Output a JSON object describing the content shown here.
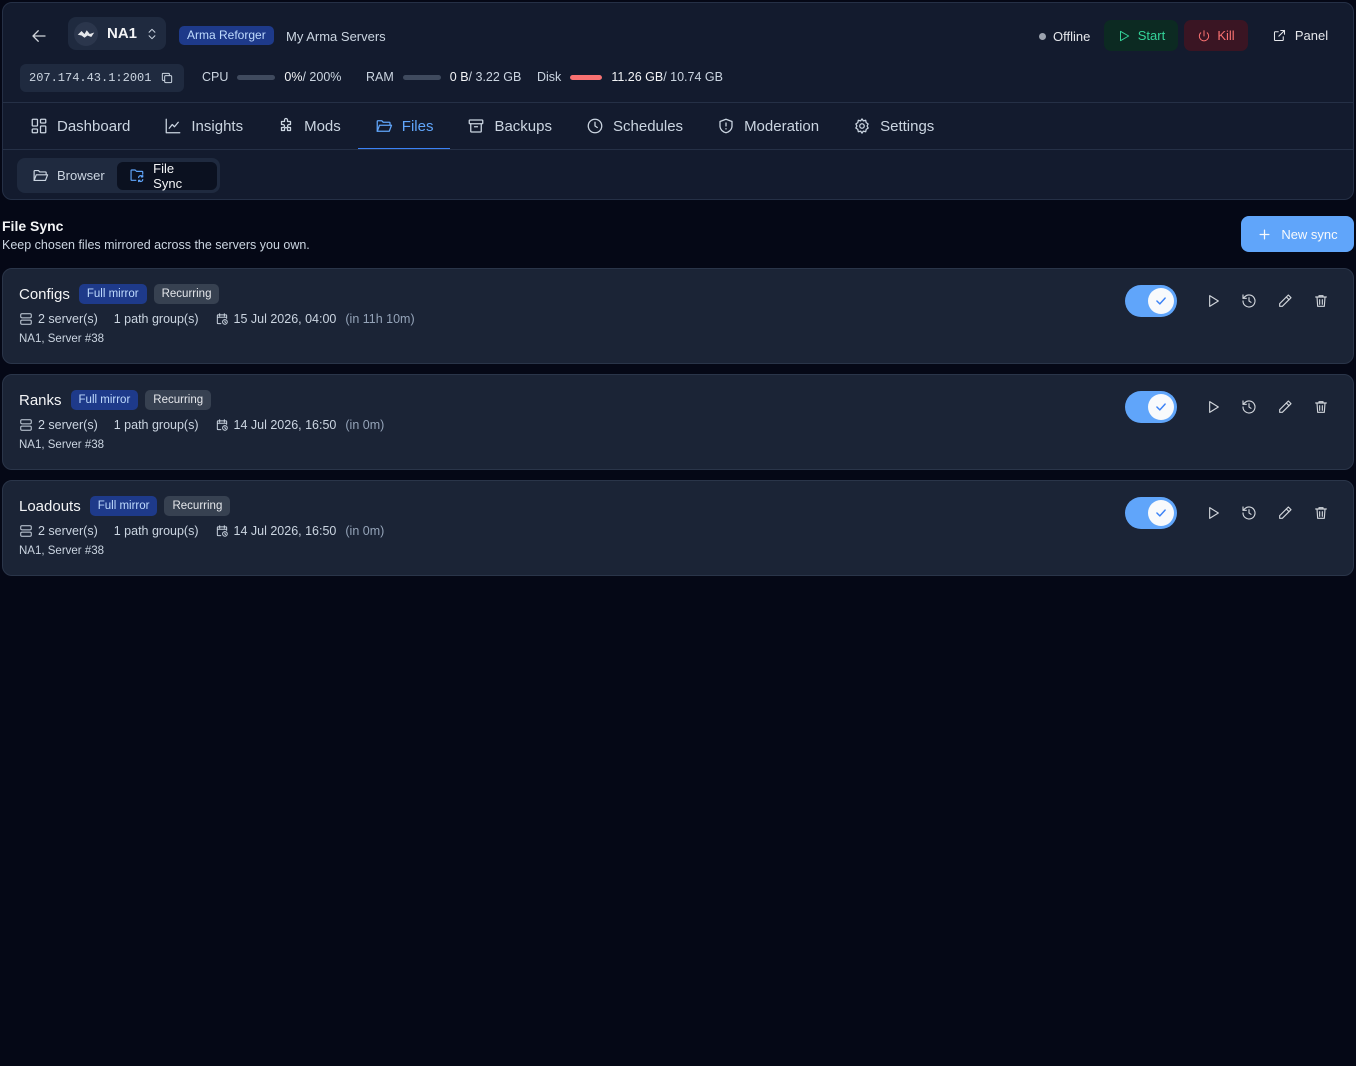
{
  "header": {
    "server_name": "NA1",
    "game_badge": "Arma Reforger",
    "group_name": "My Arma Servers",
    "status": "Offline",
    "start_label": "Start",
    "kill_label": "Kill",
    "panel_label": "Panel",
    "ip": "207.174.43.1:2001",
    "resources": {
      "cpu": {
        "label": "CPU",
        "value": "0%",
        "max": " / 200%",
        "fraction": 0
      },
      "ram": {
        "label": "RAM",
        "value": "0 B",
        "max": " / 3.22 GB",
        "fraction": 0
      },
      "disk": {
        "label": "Disk",
        "value": "11.26 GB",
        "max": " / 10.74 GB",
        "fraction": 1.0
      }
    },
    "colors": {
      "disk_bar": "#f87171",
      "accent": "#60a5fa"
    }
  },
  "tabs": [
    {
      "label": "Dashboard",
      "icon": "dashboard-icon"
    },
    {
      "label": "Insights",
      "icon": "chart-line-icon"
    },
    {
      "label": "Mods",
      "icon": "puzzle-icon"
    },
    {
      "label": "Files",
      "icon": "folder-open-icon",
      "active": true
    },
    {
      "label": "Backups",
      "icon": "archive-icon"
    },
    {
      "label": "Schedules",
      "icon": "clock-icon"
    },
    {
      "label": "Moderation",
      "icon": "shield-icon"
    },
    {
      "label": "Settings",
      "icon": "gear-icon"
    }
  ],
  "sub_tabs": [
    {
      "label": "Browser",
      "icon": "folder-open-icon"
    },
    {
      "label": "File Sync",
      "icon": "folder-sync-icon",
      "active": true
    }
  ],
  "section": {
    "title": "File Sync",
    "description": "Keep chosen files mirrored across the servers you own.",
    "new_button": "New sync"
  },
  "syncs": [
    {
      "name": "Configs",
      "mode": "Full mirror",
      "type": "Recurring",
      "servers_count": "2 server(s)",
      "path_groups": "1 path group(s)",
      "next_run": "15 Jul 2026, 04:00",
      "next_run_relative": "(in 11h 10m)",
      "servers": "NA1, Server #38",
      "enabled": true
    },
    {
      "name": "Ranks",
      "mode": "Full mirror",
      "type": "Recurring",
      "servers_count": "2 server(s)",
      "path_groups": "1 path group(s)",
      "next_run": "14 Jul 2026, 16:50",
      "next_run_relative": "(in 0m)",
      "servers": "NA1, Server #38",
      "enabled": true
    },
    {
      "name": "Loadouts",
      "mode": "Full mirror",
      "type": "Recurring",
      "servers_count": "2 server(s)",
      "path_groups": "1 path group(s)",
      "next_run": "14 Jul 2026, 16:50",
      "next_run_relative": "(in 0m)",
      "servers": "NA1, Server #38",
      "enabled": true
    }
  ]
}
